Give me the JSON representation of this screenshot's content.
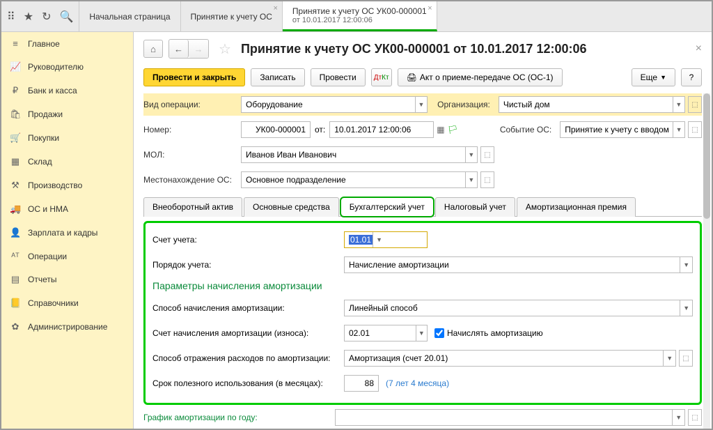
{
  "tabs": [
    {
      "label": "Начальная страница"
    },
    {
      "label": "Принятие к учету ОС"
    },
    {
      "line1": "Принятие к учету ОС УК00-000001",
      "line2": "от 10.01.2017 12:00:06"
    }
  ],
  "sidebar": [
    {
      "icon": "≡",
      "label": "Главное"
    },
    {
      "icon": "📈",
      "label": "Руководителю"
    },
    {
      "icon": "₽",
      "label": "Банк и касса"
    },
    {
      "icon": "🛍",
      "label": "Продажи"
    },
    {
      "icon": "🛒",
      "label": "Покупки"
    },
    {
      "icon": "▦",
      "label": "Склад"
    },
    {
      "icon": "⚒",
      "label": "Производство"
    },
    {
      "icon": "🚚",
      "label": "ОС и НМА"
    },
    {
      "icon": "👤",
      "label": "Зарплата и кадры"
    },
    {
      "icon": "ᴬᵀ",
      "label": "Операции"
    },
    {
      "icon": "▤",
      "label": "Отчеты"
    },
    {
      "icon": "📒",
      "label": "Справочники"
    },
    {
      "icon": "✿",
      "label": "Администрирование"
    }
  ],
  "pageTitle": "Принятие к учету ОС УК00-000001 от 10.01.2017 12:00:06",
  "toolbar": {
    "primary": "Провести и закрыть",
    "save": "Записать",
    "post": "Провести",
    "act": "Акт о приеме-передаче ОС (ОС-1)",
    "more": "Еще"
  },
  "form": {
    "opType": {
      "label": "Вид операции:",
      "value": "Оборудование"
    },
    "org": {
      "label": "Организация:",
      "value": "Чистый дом"
    },
    "number": {
      "label": "Номер:",
      "value": "УК00-000001",
      "dateLabel": "от:",
      "date": "10.01.2017 12:00:06"
    },
    "event": {
      "label": "Событие ОС:",
      "value": "Принятие к учету с вводом"
    },
    "mol": {
      "label": "МОЛ:",
      "value": "Иванов Иван Иванович"
    },
    "location": {
      "label": "Местонахождение ОС:",
      "value": "Основное подразделение"
    }
  },
  "innerTabs": [
    "Внеоборотный актив",
    "Основные средства",
    "Бухгалтерский учет",
    "Налоговый учет",
    "Амортизационная премия"
  ],
  "accounting": {
    "account": {
      "label": "Счет учета:",
      "value": "01.01"
    },
    "order": {
      "label": "Порядок учета:",
      "value": "Начисление амортизации"
    },
    "sectionTitle": "Параметры начисления амортизации",
    "method": {
      "label": "Способ начисления амортизации:",
      "value": "Линейный способ"
    },
    "deprAccount": {
      "label": "Счет начисления амортизации (износа):",
      "value": "02.01"
    },
    "calcDepr": "Начислять амортизацию",
    "expense": {
      "label": "Способ отражения расходов по амортизации:",
      "value": "Амортизация (счет 20.01)"
    },
    "life": {
      "label": "Срок полезного использования (в месяцах):",
      "value": "88",
      "hint": "(7 лет 4 месяца)"
    },
    "schedule": {
      "label": "График амортизации по году:"
    }
  }
}
